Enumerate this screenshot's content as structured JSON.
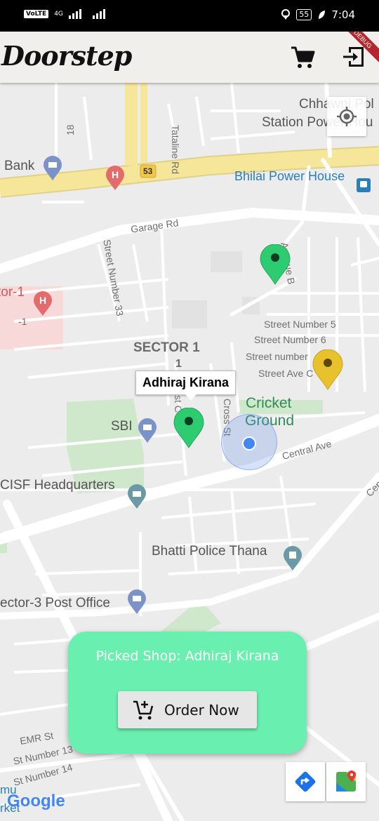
{
  "status_bar": {
    "volte": "VoLTE",
    "network": "4G",
    "battery": "55",
    "time": "7:04"
  },
  "app_bar": {
    "title": "Doorstep",
    "debug_banner": "DEBUG"
  },
  "map": {
    "labels": {
      "chhawni_line1": "Chhawni Pol",
      "chhawni_line2": "Station Power Hou",
      "tataline": "Tataline Rd",
      "road18": "18",
      "bank": "Bank",
      "hwy53": "53",
      "bhilai_power_house": "Bhilai Power House",
      "garage_rd": "Garage Rd",
      "street33": "Street Number 33",
      "avenue_b": "Avenue B",
      "sector1_left": "tor-1",
      "sector1_left_num": "-1",
      "street5": "Street Number 5",
      "street6": "Street Number 6",
      "street_number": "Street number",
      "street_ave_c": "Street Ave C",
      "sector1_title": "SECTOR 1",
      "sector1_num": "1",
      "cricket_ground_1": "Cricket",
      "cricket_ground_2": "Ground",
      "cross_st": "Cross St",
      "west_c_rd": "st C Rd",
      "sbi": "SBI",
      "central_ave": "Central Ave",
      "cisf": "CISF Headquarters",
      "cen": "Cen",
      "bhatti": "Bhatti Police Thana",
      "sector3_post": "ector-3 Post Office",
      "emr_st": "EMR St",
      "st13": "St Number 13",
      "st14": "St Number 14",
      "market_1": "mu",
      "market_2": "rket"
    },
    "callout": "Adhiraj Kirana",
    "google": "Google",
    "colors": {
      "shop_pin": "#2ecc71",
      "other_pin": "#e8c22d",
      "poi_blue": "#7b93c8",
      "poi_red": "#e36b6b",
      "poi_teal": "#6b9aa5",
      "highway": "#f6e69a"
    }
  },
  "panel": {
    "picked_shop": "Picked Shop: Adhiraj Kirana",
    "order_button": "Order Now",
    "bg_color": "#69efb0"
  }
}
